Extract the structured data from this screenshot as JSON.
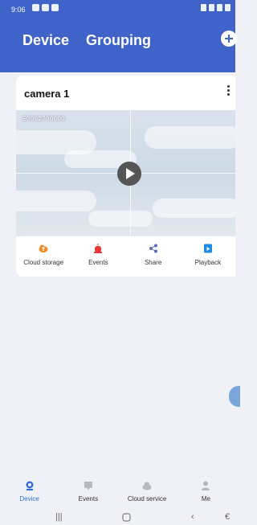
{
  "status_bar": {
    "time": "9:06"
  },
  "header": {
    "tabs": [
      {
        "label": "Device"
      },
      {
        "label": "Grouping"
      }
    ],
    "add_icon": "plus-circle-icon"
  },
  "device_card": {
    "name": "camera 1",
    "device_id": "E0062700000",
    "actions": [
      {
        "label": "Cloud storage",
        "icon": "cloud-storage-icon",
        "color": "#f08a24"
      },
      {
        "label": "Events",
        "icon": "alarm-icon",
        "color": "#e53935"
      },
      {
        "label": "Share",
        "icon": "share-icon",
        "color": "#5c6bc0"
      },
      {
        "label": "Playback",
        "icon": "playback-icon",
        "color": "#1e88e5"
      }
    ]
  },
  "bottom_nav": [
    {
      "label": "Device",
      "icon": "device-icon",
      "active": true
    },
    {
      "label": "Events",
      "icon": "events-icon",
      "active": false
    },
    {
      "label": "Cloud service",
      "icon": "cloud-icon",
      "active": false
    },
    {
      "label": "Me",
      "icon": "person-icon",
      "active": false
    }
  ],
  "colors": {
    "header": "#3f63c8",
    "background": "#f0f1f6",
    "accent": "#2f6fe0"
  }
}
